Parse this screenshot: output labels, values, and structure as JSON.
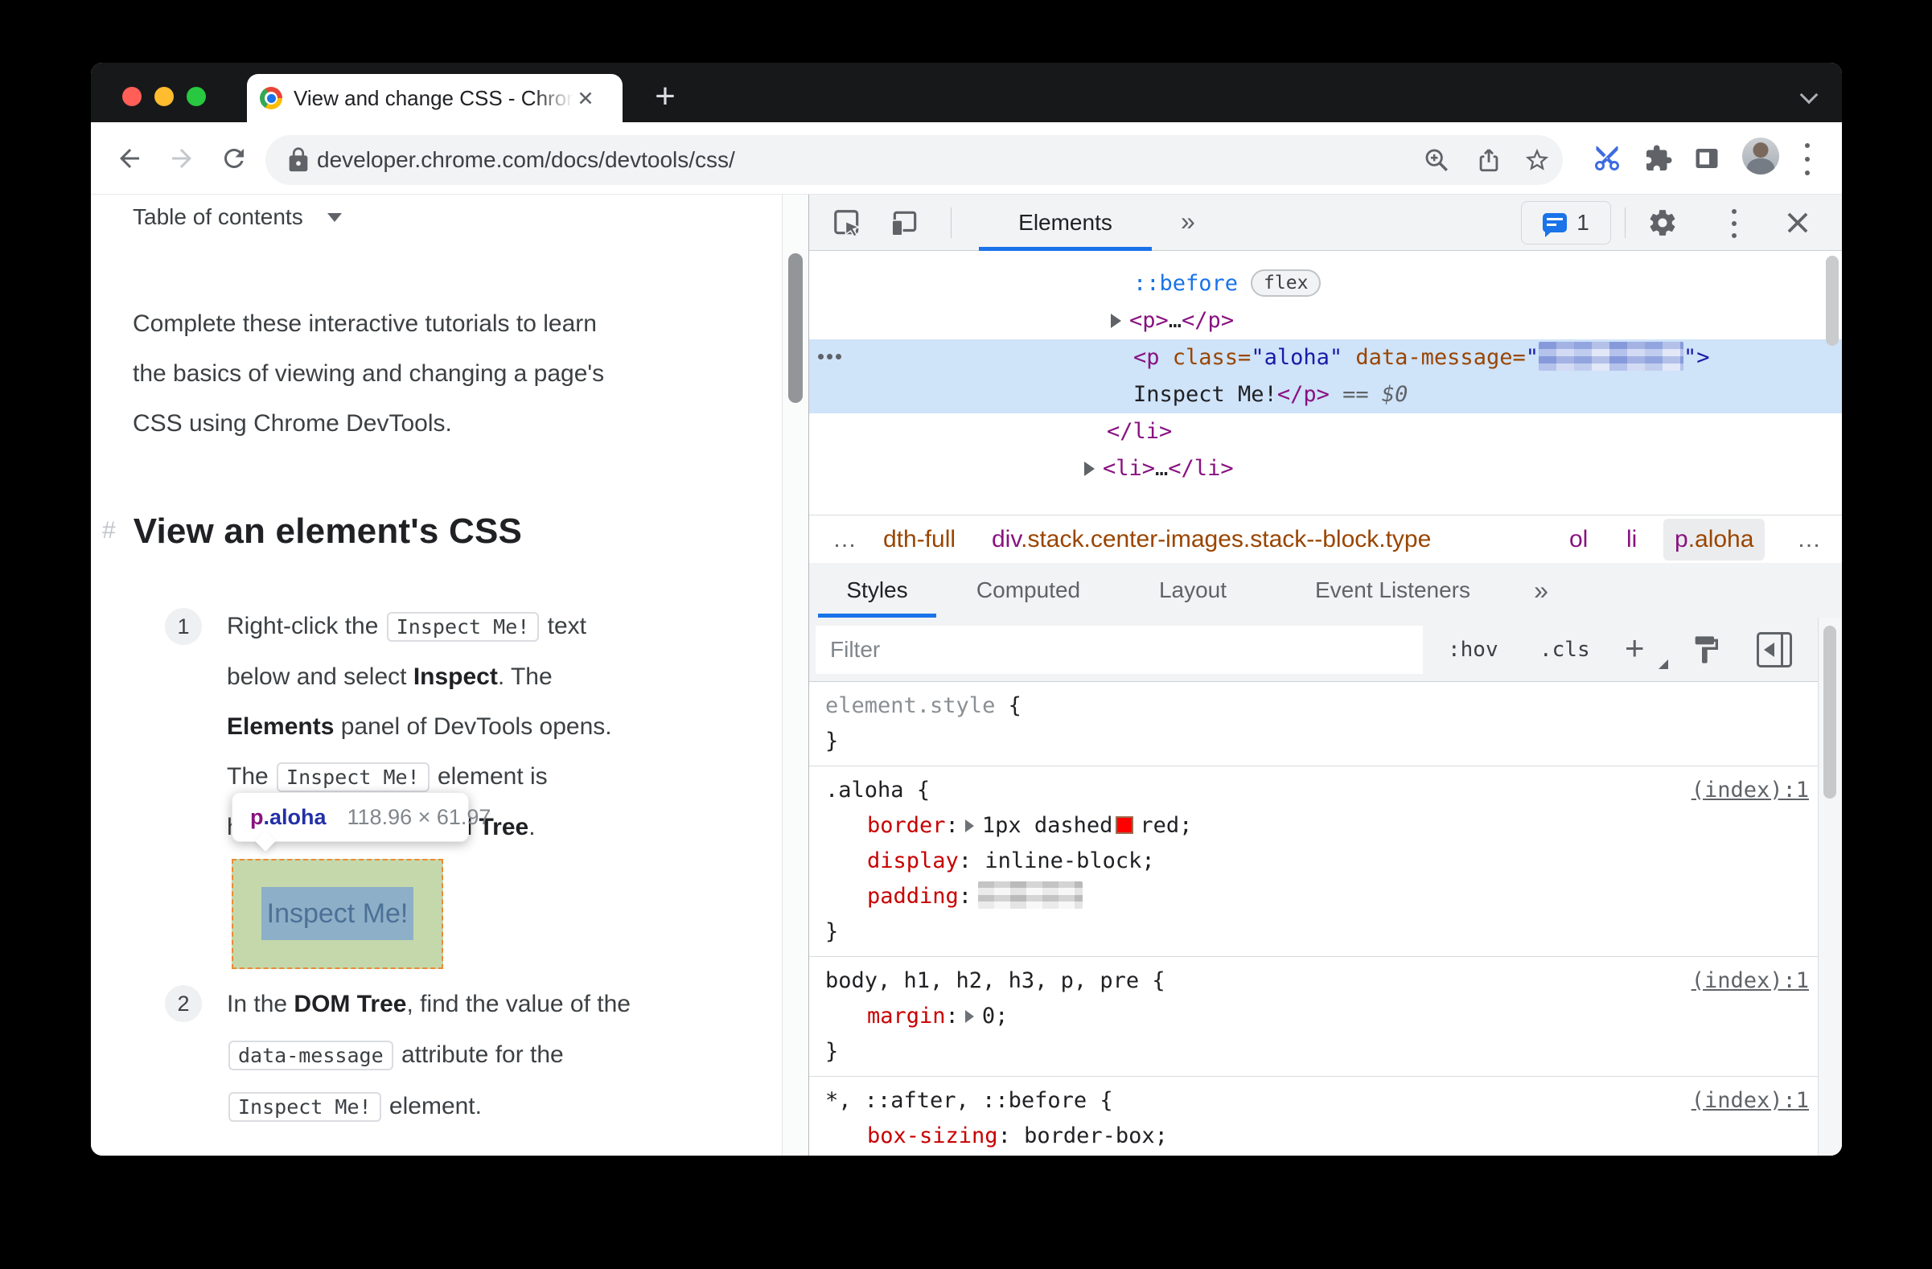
{
  "colors": {
    "accent_blue": "#1a73e8",
    "tag_purple": "#881280",
    "attr_orange": "#994500",
    "value_blue": "#1a1aa6",
    "property_red": "#c80000",
    "dom_selection_bg": "#cfe3f9",
    "inspect_overlay_green": "#c5d8ab",
    "inspect_overlay_border": "#ec8a33",
    "traffic_red": "#ff5f57",
    "traffic_yellow": "#febc2e",
    "traffic_green": "#28c840"
  },
  "browser": {
    "tab_title": "View and change CSS - Chrome",
    "url": "developer.chrome.com/docs/devtools/css/",
    "new_tab_plus": "+"
  },
  "page": {
    "toc_label": "Table of contents",
    "intro_line1": "Complete these interactive tutorials to learn",
    "intro_line2": "the basics of viewing and changing a page's",
    "intro_line3": "CSS using Chrome DevTools.",
    "heading_hash": "#",
    "heading": "View an element's CSS",
    "step1_num": "1",
    "step1_l1a": "Right-click the ",
    "step1_l1code": "Inspect Me!",
    "step1_l1b": " text",
    "step1_l2a": "below and select ",
    "step1_l2bold": "Inspect",
    "step1_l2b": ". The",
    "step1_l3bold": "Elements",
    "step1_l3a": " panel of DevTools opens.",
    "step1_l4a": "The ",
    "step1_l4code": "Inspect Me!",
    "step1_l4b": " element is",
    "step1_l5a": "highlighted in the ",
    "step1_l5bold": "DOM Tree",
    "step1_l5b": ".",
    "tooltip_tag": "p",
    "tooltip_class": ".aloha",
    "tooltip_dims": "118.96 × 61.97",
    "demo_text": "Inspect Me!",
    "step2_num": "2",
    "step2_l1a": "In the ",
    "step2_l1bold": "DOM Tree",
    "step2_l1b": ", find the value of the",
    "step2_l2code": "data-message",
    "step2_l2a": " attribute for the",
    "step2_l3code": "Inspect Me!",
    "step2_l3a": " element."
  },
  "devtools": {
    "elements_tab": "Elements",
    "more_tabs": "»",
    "issues_count": "1",
    "dom": {
      "row1_pseudo": "::before",
      "row1_badge": "flex",
      "row2_open": "<p>",
      "row2_dots": "…",
      "row2_close": "</p>",
      "sel_tag_open": "<p",
      "sel_attr1": "class=",
      "sel_val1": "\"aloha\"",
      "sel_attr2": "data-message=",
      "sel_quote_open": "\"",
      "sel_quote_close": "\">",
      "sel_text": "Inspect Me!",
      "sel_tag_close": "</p>",
      "sel_eq": "==",
      "sel_dollar": "$0",
      "row4_close": "</li>",
      "row5_open": "<li>",
      "row5_dots": "…",
      "row5_close": "</li>"
    },
    "crumbs": {
      "c1": "…",
      "c2": "dth-full",
      "c3_tag": "div",
      "c3_cls": ".stack.center-images.stack--block.type",
      "c4": "ol",
      "c5": "li",
      "c6_tag": "p",
      "c6_cls": ".aloha",
      "c7": "…"
    },
    "tabs": [
      "Styles",
      "Computed",
      "Layout",
      "Event Listeners"
    ],
    "tabs_more": "»",
    "filter_placeholder": "Filter",
    "hov": ":hov",
    "cls": ".cls",
    "plus": "+",
    "styles": {
      "colon": ":",
      "open_brace": "{",
      "close_brace": "}",
      "s1_selector": "element.style",
      "s2_selector": ".aloha",
      "s2_link": "(index):1",
      "border_name": "border",
      "border_value": "1px dashed",
      "border_color": "red;",
      "display_name": "display",
      "display_value": "inline-block;",
      "padding_name": "padding",
      "s3_selector": "body, h1, h2, h3, p, pre",
      "s3_link": "(index):1",
      "margin_name": "margin",
      "margin_value": "0;",
      "s4_selector": "*, ::after, ::before",
      "s4_link": "(index):1",
      "boxsizing_name": "box-sizing",
      "boxsizing_value": "border-box;"
    }
  }
}
